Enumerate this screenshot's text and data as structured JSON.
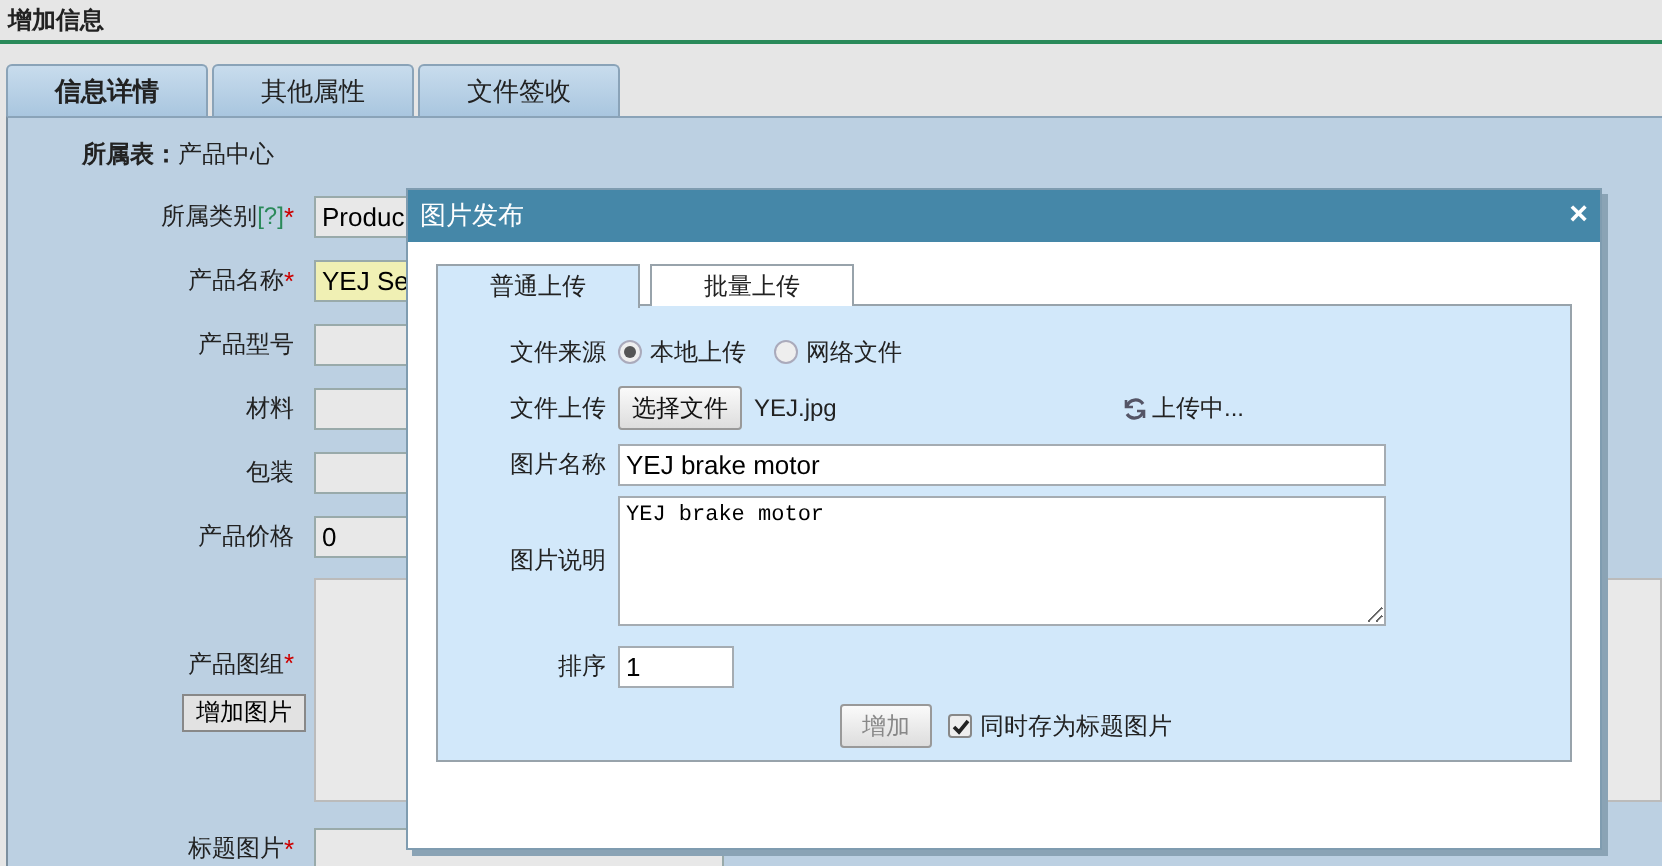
{
  "page": {
    "title": "增加信息"
  },
  "tabs": [
    {
      "label": "信息详情",
      "selected": true
    },
    {
      "label": "其他属性",
      "selected": false
    },
    {
      "label": "文件签收",
      "selected": false
    }
  ],
  "owner_table": {
    "label": "所属表：",
    "value": "产品中心"
  },
  "fields": [
    {
      "kind": "select",
      "label": "所属类别",
      "help": "[?]",
      "required_mark": "*",
      "value": "Produc"
    },
    {
      "kind": "text",
      "label": "产品名称",
      "required_mark": "*",
      "value": "YEJ Se",
      "highlighted": true
    },
    {
      "kind": "text",
      "label": "产品型号"
    },
    {
      "kind": "text",
      "label": "材料"
    },
    {
      "kind": "text",
      "label": "包装"
    },
    {
      "kind": "text",
      "label": "产品价格",
      "value": "0"
    },
    {
      "kind": "gallery",
      "label": "产品图组",
      "required_mark": "*",
      "button": "增加图片"
    },
    {
      "kind": "text",
      "label": "标题图片",
      "required_mark": "*"
    }
  ],
  "dialog": {
    "title": "图片发布",
    "close": "×",
    "tabs": [
      {
        "label": "普通上传",
        "selected": true
      },
      {
        "label": "批量上传",
        "selected": false
      }
    ],
    "source": {
      "label": "文件来源",
      "options": [
        {
          "label": "本地上传",
          "selected": true
        },
        {
          "label": "网络文件",
          "selected": false
        }
      ]
    },
    "upload": {
      "label": "文件上传",
      "button": "选择文件",
      "file": "YEJ.jpg",
      "status": "上传中..."
    },
    "name": {
      "label": "图片名称",
      "value": "YEJ brake motor"
    },
    "description": {
      "label": "图片说明",
      "value": "YEJ brake motor"
    },
    "order": {
      "label": "排序",
      "value": "1"
    },
    "add_button": {
      "label": "增加",
      "disabled": true
    },
    "title_image": {
      "label": "同时存为标题图片",
      "checked": true
    }
  }
}
